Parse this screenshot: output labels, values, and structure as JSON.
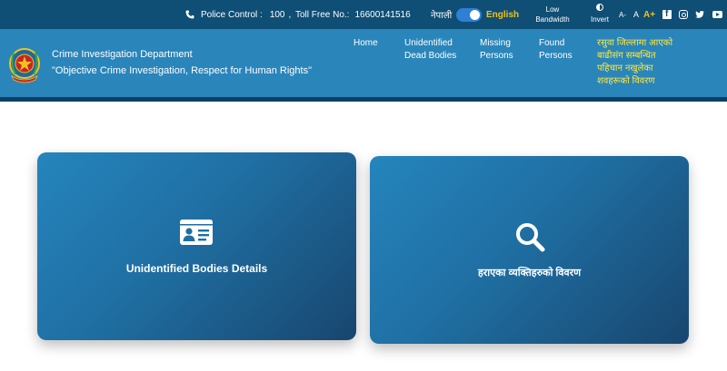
{
  "topbar": {
    "police_control_label": "Police Control :",
    "police_control_number": "100",
    "separator": ",",
    "toll_free_label": "Toll Free No.:",
    "toll_free_number": "16600141516",
    "language_nepali": "नेपाली",
    "language_english": "English",
    "low_bandwidth": [
      "Low",
      "Bandwidth"
    ],
    "invert": "Invert",
    "font_decrease": "A-",
    "font_normal": "A",
    "font_increase": "A+",
    "social_icons": [
      "facebook-icon",
      "instagram-icon",
      "twitter-icon",
      "youtube-icon"
    ]
  },
  "header": {
    "department": "Crime Investigation Department",
    "motto": "\"Objective Crime Investigation, Respect for Human Rights\"",
    "nav": [
      {
        "label": "Home"
      },
      {
        "label": "Unidentified Dead Bodies"
      },
      {
        "label": "Missing Persons"
      },
      {
        "label": "Found Persons"
      },
      {
        "label": "रसुवा जिल्लामा आएको बाढीसंग सम्बन्धित पहिचान नखुलेका शवहरूको विवरण"
      }
    ]
  },
  "cards": [
    {
      "label": "Unidentified Bodies Details",
      "icon": "id-card-icon"
    },
    {
      "label": "हराएका व्यक्तिहरुको विवरण",
      "icon": "search-icon"
    }
  ],
  "colors": {
    "topbar_bg": "#0f4e75",
    "header_bg": "#2a85bb",
    "accent_yellow": "#f2c21a",
    "card_gradient_start": "#2585bd",
    "card_gradient_end": "#18466f"
  }
}
